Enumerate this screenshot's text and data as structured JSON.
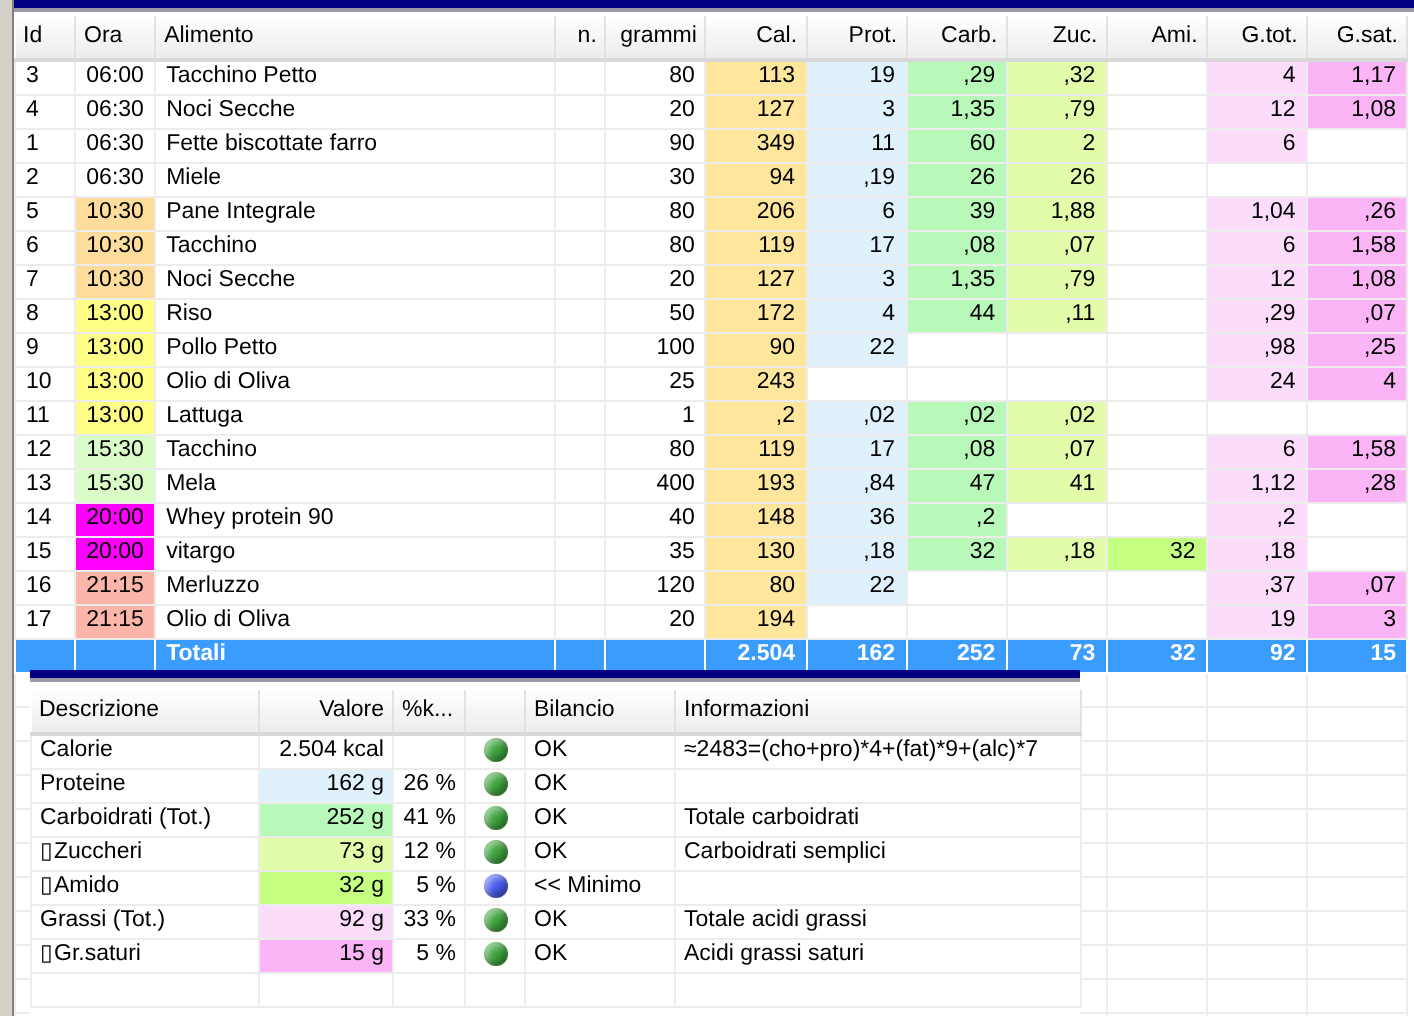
{
  "table": {
    "columns": [
      {
        "label": "Id",
        "kind": "text"
      },
      {
        "label": "Ora",
        "kind": "time"
      },
      {
        "label": "Alimento",
        "kind": "text"
      },
      {
        "label": "n.",
        "kind": "num"
      },
      {
        "label": "grammi",
        "kind": "num"
      },
      {
        "label": "Cal.",
        "kind": "num",
        "color": "#fee79c"
      },
      {
        "label": "Prot.",
        "kind": "num",
        "color": "#dff1fb"
      },
      {
        "label": "Carb.",
        "kind": "num",
        "color": "#b8f8b8"
      },
      {
        "label": "Zuc.",
        "kind": "num",
        "color": "#e3fcaa"
      },
      {
        "label": "Ami.",
        "kind": "num",
        "color": "#c4ff82"
      },
      {
        "label": "G.tot.",
        "kind": "num",
        "color": "#fcdcfb"
      },
      {
        "label": "G.sat.",
        "kind": "num",
        "color": "#fbb5f6"
      }
    ],
    "rows": [
      {
        "cells": [
          "3",
          "06:00",
          "Tacchino Petto",
          null,
          "80",
          "113",
          "19",
          ",29",
          ",32",
          null,
          "4",
          "1,17"
        ]
      },
      {
        "cells": [
          "4",
          "06:30",
          "Noci Secche",
          null,
          "20",
          "127",
          "3",
          "1,35",
          ",79",
          null,
          "12",
          "1,08"
        ]
      },
      {
        "cells": [
          "1",
          "06:30",
          "Fette biscottate farro",
          null,
          "90",
          "349",
          "11",
          "60",
          "2",
          null,
          "6",
          null
        ]
      },
      {
        "cells": [
          "2",
          "06:30",
          "Miele",
          null,
          "30",
          "94",
          ",19",
          "26",
          "26",
          null,
          null,
          null
        ]
      },
      {
        "color": "#fddc9c",
        "cells": [
          "5",
          "10:30",
          "Pane Integrale",
          null,
          "80",
          "206",
          "6",
          "39",
          "1,88",
          null,
          "1,04",
          ",26"
        ]
      },
      {
        "color": "#fddc9c",
        "cells": [
          "6",
          "10:30",
          "Tacchino",
          null,
          "80",
          "119",
          "17",
          ",08",
          ",07",
          null,
          "6",
          "1,58"
        ]
      },
      {
        "color": "#fddc9c",
        "cells": [
          "7",
          "10:30",
          "Noci Secche",
          null,
          "20",
          "127",
          "3",
          "1,35",
          ",79",
          null,
          "12",
          "1,08"
        ]
      },
      {
        "color": "#ffff88",
        "cells": [
          "8",
          "13:00",
          "Riso",
          null,
          "50",
          "172",
          "4",
          "44",
          ",11",
          null,
          ",29",
          ",07"
        ]
      },
      {
        "color": "#ffff88",
        "cells": [
          "9",
          "13:00",
          "Pollo Petto",
          null,
          "100",
          "90",
          "22",
          null,
          null,
          null,
          ",98",
          ",25"
        ]
      },
      {
        "color": "#ffff88",
        "cells": [
          "10",
          "13:00",
          "Olio di Oliva",
          null,
          "25",
          "243",
          null,
          null,
          null,
          null,
          "24",
          "4"
        ]
      },
      {
        "color": "#ffff88",
        "cells": [
          "11",
          "13:00",
          "Lattuga",
          null,
          "1",
          ",2",
          ",02",
          ",02",
          ",02",
          null,
          null,
          null
        ]
      },
      {
        "color": "#d9fcc9",
        "cells": [
          "12",
          "15:30",
          "Tacchino",
          null,
          "80",
          "119",
          "17",
          ",08",
          ",07",
          null,
          "6",
          "1,58"
        ]
      },
      {
        "color": "#d9fcc9",
        "cells": [
          "13",
          "15:30",
          "Mela",
          null,
          "400",
          "193",
          ",84",
          "47",
          "41",
          null,
          "1,12",
          ",28"
        ]
      },
      {
        "color": "#ff00ff",
        "cells": [
          "14",
          "20:00",
          "Whey protein 90",
          null,
          "40",
          "148",
          "36",
          ",2",
          null,
          null,
          ",2",
          null
        ]
      },
      {
        "color": "#ff00ff",
        "cells": [
          "15",
          "20:00",
          "vitargo",
          null,
          "35",
          "130",
          ",18",
          "32",
          ",18",
          "32",
          ",18",
          null
        ]
      },
      {
        "color": "#fcb5a9",
        "cells": [
          "16",
          "21:15",
          "Merluzzo",
          null,
          "120",
          "80",
          "22",
          null,
          null,
          null,
          ",37",
          ",07"
        ]
      },
      {
        "color": "#fcb5a9",
        "cells": [
          "17",
          "21:15",
          "Olio di Oliva",
          null,
          "20",
          "194",
          null,
          null,
          null,
          null,
          "19",
          "3"
        ]
      }
    ],
    "totals": {
      "cells": [
        null,
        null,
        "Totali",
        null,
        null,
        "2.504",
        "162",
        "252",
        "73",
        "32",
        "92",
        "15"
      ]
    }
  },
  "summary": {
    "columns": [
      {
        "kind": "descrizione",
        "label": "Descrizione"
      },
      {
        "kind": "valore",
        "label": "Valore"
      },
      {
        "kind": "percentuale",
        "label": "%k..."
      },
      {
        "kind": "status"
      },
      {
        "kind": "bilancio",
        "label": "Bilancio"
      },
      {
        "kind": "informazioni",
        "label": "Informazioni"
      }
    ],
    "rows": [
      {
        "descrizione": "Calorie",
        "valore": {
          "text": "2.504 kcal"
        },
        "status": {
          "color": "#3fa33f"
        },
        "bilancio": "OK",
        "informazioni": "≈2483=(cho+pro)*4+(fat)*9+(alc)*7"
      },
      {
        "descrizione": "Proteine",
        "valore": {
          "text": "162 g",
          "color": "#dff1fb"
        },
        "percentuale": "26 %",
        "status": {
          "color": "#3fa33f"
        },
        "bilancio": "OK"
      },
      {
        "descrizione": "Carboidrati (Tot.)",
        "valore": {
          "text": "252 g",
          "color": "#b8f8b8"
        },
        "percentuale": "41 %",
        "status": {
          "color": "#3fa33f"
        },
        "bilancio": "OK",
        "informazioni": "Totale carboidrati"
      },
      {
        "descrizione": "▯Zuccheri",
        "valore": {
          "text": "73 g",
          "color": "#e3fcaa"
        },
        "percentuale": "12 %",
        "status": {
          "color": "#3fa33f"
        },
        "bilancio": "OK",
        "informazioni": "Carboidrati semplici"
      },
      {
        "descrizione": "▯Amido",
        "valore": {
          "text": "32 g",
          "color": "#c4ff82"
        },
        "percentuale": "5 %",
        "status": {
          "color": "#4a5cf0"
        },
        "bilancio": "<< Minimo"
      },
      {
        "descrizione": "Grassi (Tot.)",
        "valore": {
          "text": "92 g",
          "color": "#fcdcfb"
        },
        "percentuale": "33 %",
        "status": {
          "color": "#3fa33f"
        },
        "bilancio": "OK",
        "informazioni": "Totale acidi grassi"
      },
      {
        "descrizione": "▯Gr.saturi",
        "valore": {
          "text": "15 g",
          "color": "#fbb5f6"
        },
        "percentuale": "5 %",
        "status": {
          "color": "#3fa33f"
        },
        "bilancio": "OK",
        "informazioni": "Acidi grassi saturi"
      }
    ]
  }
}
